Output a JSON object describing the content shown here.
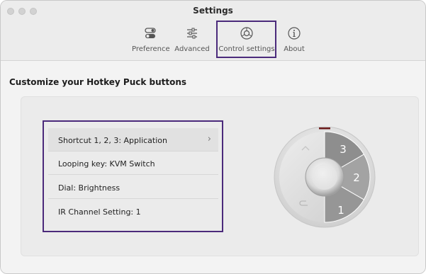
{
  "window": {
    "title": "Settings"
  },
  "toolbar": {
    "tabs": [
      {
        "label": "Preference",
        "icon": "toggle-icon"
      },
      {
        "label": "Advanced",
        "icon": "sliders-icon"
      },
      {
        "label": "Control settings",
        "icon": "dial-icon",
        "selected": true
      },
      {
        "label": "About",
        "icon": "info-icon"
      }
    ]
  },
  "main": {
    "heading": "Customize your Hotkey Puck buttons",
    "items": [
      {
        "label": "Shortcut 1, 2, 3: Application",
        "selected": true
      },
      {
        "label": "Looping key: KVM Switch"
      },
      {
        "label": "Dial: Brightness"
      },
      {
        "label": "IR Channel Setting: 1"
      }
    ]
  },
  "puck": {
    "button_labels": [
      "3",
      "2",
      "1"
    ]
  },
  "colors": {
    "highlight": "#4b2a7b",
    "puck_dark": "#8d8d8d",
    "puck_light": "#dcdcdc"
  }
}
